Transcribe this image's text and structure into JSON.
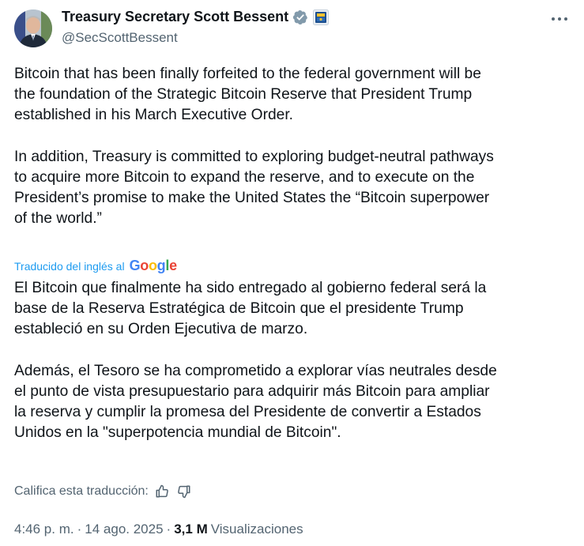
{
  "author": {
    "display_name": "Treasury Secretary Scott Bessent",
    "handle": "@SecScottBessent"
  },
  "tweet": {
    "original_text": "Bitcoin that has been finally forfeited to the federal government will be\nthe foundation of the Strategic Bitcoin Reserve that President Trump\nestablished in his March Executive Order.\n\nIn addition, Treasury is committed to exploring budget-neutral pathways\nto acquire more Bitcoin to expand the reserve, and to execute on the\nPresident’s promise to make the United States the “Bitcoin superpower\nof the world.”",
    "translated_by_label": "Traducido del inglés al",
    "translation_provider": "Google",
    "translated_text": "El Bitcoin que finalmente ha sido entregado al gobierno federal será la\nbase de la Reserva Estratégica de Bitcoin que el presidente Trump\nestableció en su Orden Ejecutiva de marzo.\n\nAdemás, el Tesoro se ha comprometido a explorar vías neutrales desde\nel punto de vista presupuestario para adquirir más Bitcoin para ampliar\nla reserva y cumplir la promesa del Presidente de convertir a Estados\nUnidos en la \"superpotencia mundial de Bitcoin\".",
    "rate_translation_label": "Califica esta traducción:"
  },
  "meta": {
    "time": "4:46 p. m.",
    "separator": "·",
    "date": "14 ago. 2025",
    "views_count": "3,1 M",
    "views_label": "Visualizaciones"
  },
  "icons": {
    "verified": "gray-checkmark-badge-icon",
    "affiliation": "treasury-seal-icon",
    "more": "more-horizontal-icon",
    "thumbs_up": "thumbs-up-icon",
    "thumbs_down": "thumbs-down-icon"
  },
  "colors": {
    "text": "#0f1419",
    "secondary": "#536471",
    "link": "#1d9bf0",
    "badge_gray": "#829aab"
  }
}
